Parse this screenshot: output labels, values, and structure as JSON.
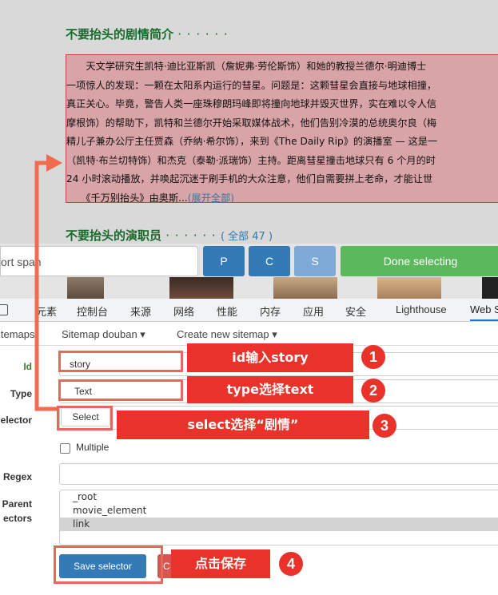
{
  "page": {
    "synopsis_title": "不要抬头的剧情简介",
    "synopsis_dots": "· · · · · ·",
    "synopsis_lines": [
      "　　天文学研究生凯特·迪比亚斯凯（詹妮弗·劳伦斯饰）和她的教授兰德尔·明迪博士",
      "一项惊人的发现：一颗在太阳系内运行的彗星。问题是：这颗彗星会直接与地球相撞，",
      "真正关心。毕竟，警告人类一座珠穆朗玛峰即将撞向地球并毁灭世界，实在难以令人信",
      "摩根饰）的帮助下，凯特和兰德尔开始采取媒体战术，他们告别冷漠的总统奥尔良（梅",
      "精儿子兼办公厅主任贾森（乔纳·希尔饰），来到《The Daily Rip》的演播室 — 这是一",
      "（凯特·布兰切特饰）和杰克（泰勒·派瑞饰）主持。距离彗星撞击地球只有 6 个月的时",
      "24 小时滚动播放，并唤起沉迷于刷手机的大众注意，他们自需要拼上老命，才能让世"
    ],
    "synopsis_last": "　　《千万别抬头》由奥斯...",
    "synopsis_more": "(展开全部)",
    "cast_title": "不要抬头的演职员",
    "cast_dots": "· · · · · ·",
    "cast_all": "( 全部 47 )"
  },
  "toolbar": {
    "selector_value": "ort span",
    "btn_p": "P",
    "btn_c": "C",
    "btn_s": "S",
    "btn_done": "Done selecting"
  },
  "devtools": {
    "tabs": [
      "元素",
      "控制台",
      "来源",
      "网络",
      "性能",
      "内存",
      "应用",
      "安全",
      "Lighthouse",
      "Web S"
    ],
    "sitemap_items": [
      "itemaps",
      "Sitemap douban ▾",
      "Create new sitemap ▾"
    ]
  },
  "form": {
    "id_label": "Id",
    "id_value": "story",
    "type_label": "Type",
    "type_value": "Text",
    "selector_label": "elector",
    "select_button": "Select",
    "multiple_label": "Multiple",
    "regex_label": "Regex",
    "parent_label_1": "Parent",
    "parent_label_2": "ectors",
    "parent_options": [
      "_root",
      "movie_element",
      "link"
    ],
    "save_button": "Save selector",
    "next_button_partial": "C"
  },
  "annotations": {
    "step1": "id输入story",
    "step2": "type选择text",
    "step3": "select选择“剧情”",
    "step4": "点击保存",
    "n1": "1",
    "n2": "2",
    "n3": "3",
    "n4": "4"
  },
  "colors": {
    "annotation_red": "#e8322a",
    "highlight_box": "#c94040",
    "primary_blue": "#337ab7",
    "done_green": "#5cb85c",
    "douban_green": "#166b2a"
  }
}
